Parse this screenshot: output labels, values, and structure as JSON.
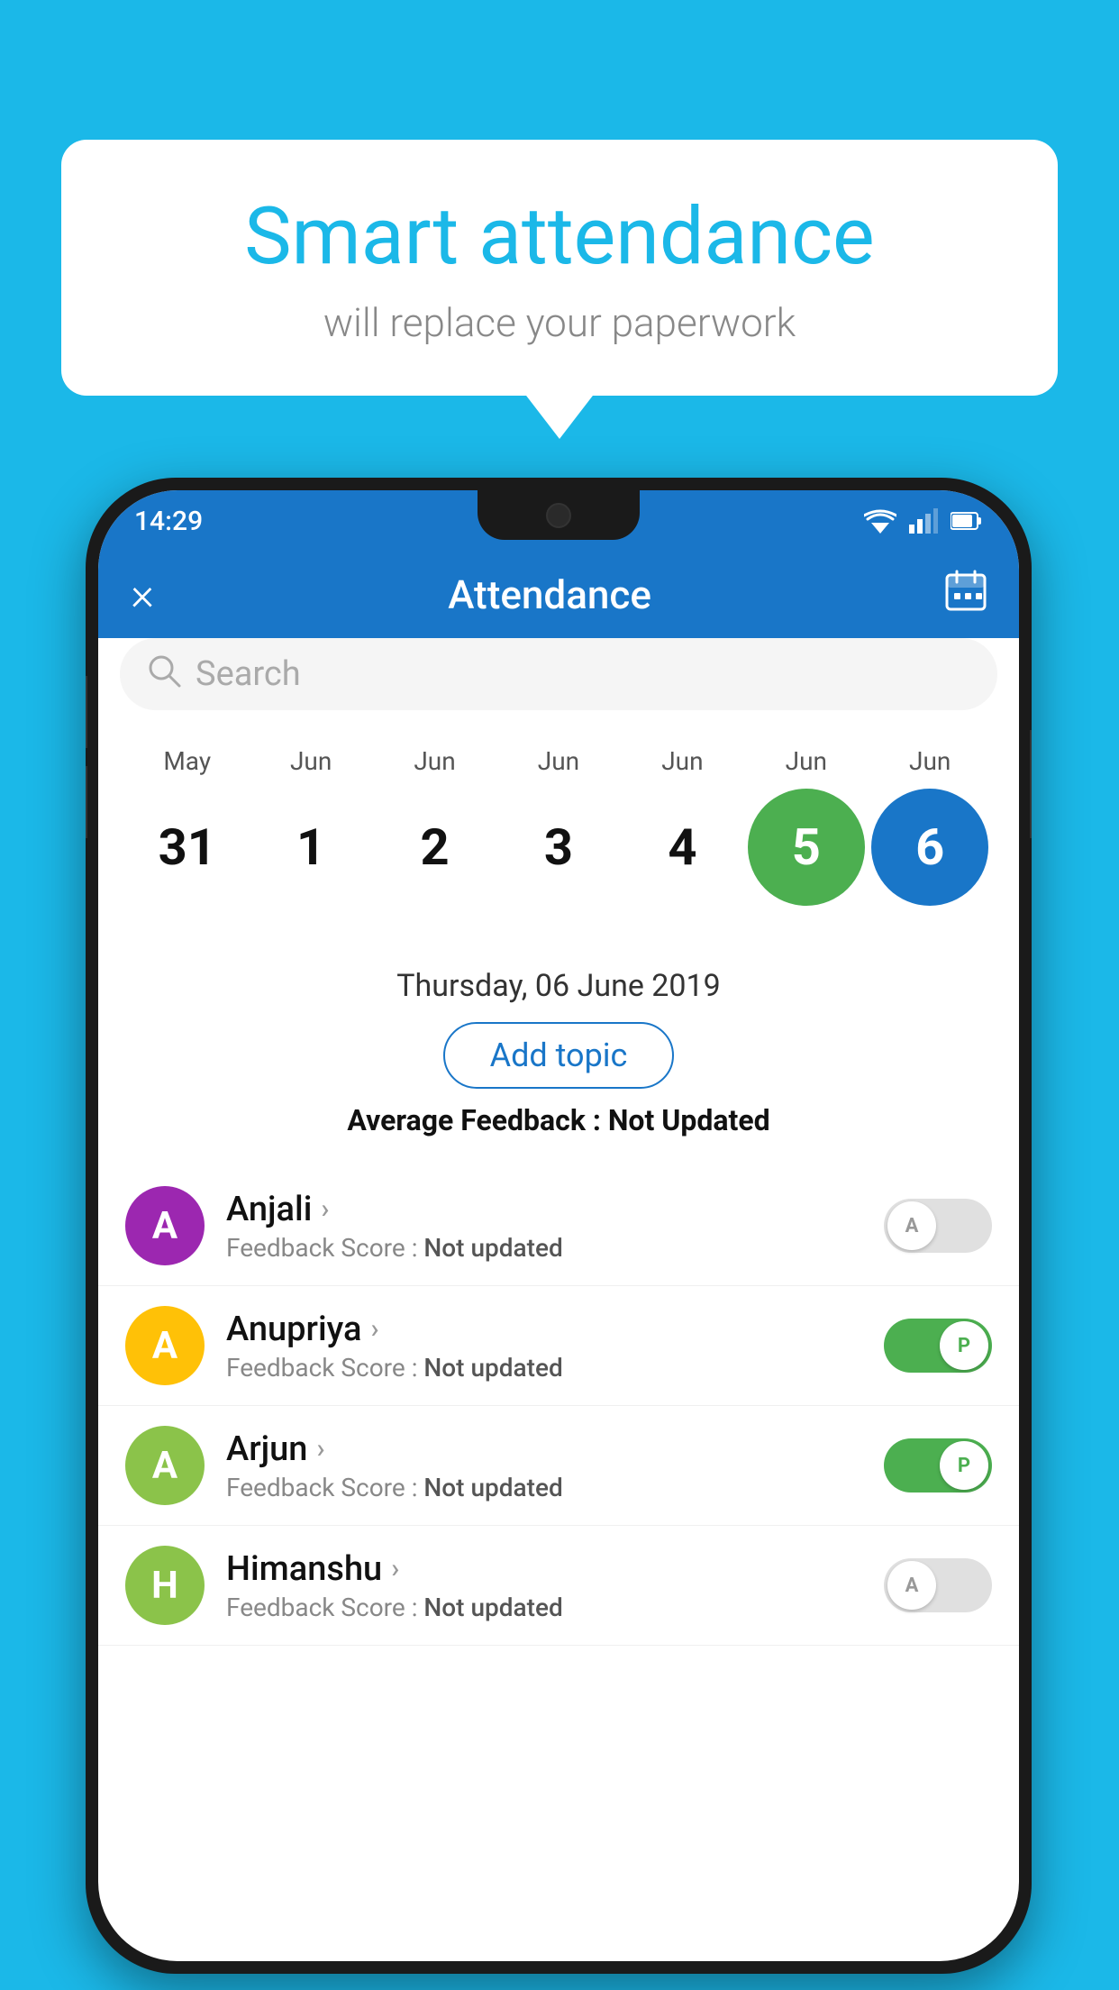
{
  "background": {
    "color": "#1BB8E8"
  },
  "speech_bubble": {
    "title": "Smart attendance",
    "subtitle": "will replace your paperwork"
  },
  "status_bar": {
    "time": "14:29"
  },
  "app_bar": {
    "title": "Attendance",
    "close_label": "×",
    "calendar_icon": "📅"
  },
  "search": {
    "placeholder": "Search"
  },
  "calendar": {
    "months": [
      "May",
      "Jun",
      "Jun",
      "Jun",
      "Jun",
      "Jun",
      "Jun"
    ],
    "dates": [
      "31",
      "1",
      "2",
      "3",
      "4",
      "5",
      "6"
    ],
    "today_green_index": 5,
    "today_blue_index": 6,
    "selected_date": "Thursday, 06 June 2019"
  },
  "add_topic": {
    "label": "Add topic"
  },
  "avg_feedback": {
    "label": "Average Feedback : ",
    "value": "Not Updated"
  },
  "students": [
    {
      "name": "Anjali",
      "initial": "A",
      "avatar_color": "#9C27B0",
      "feedback_label": "Feedback Score : ",
      "feedback_value": "Not updated",
      "toggle_state": "off",
      "toggle_label": "A"
    },
    {
      "name": "Anupriya",
      "initial": "A",
      "avatar_color": "#FFC107",
      "feedback_label": "Feedback Score : ",
      "feedback_value": "Not updated",
      "toggle_state": "on",
      "toggle_label": "P"
    },
    {
      "name": "Arjun",
      "initial": "A",
      "avatar_color": "#8BC34A",
      "feedback_label": "Feedback Score : ",
      "feedback_value": "Not updated",
      "toggle_state": "on",
      "toggle_label": "P"
    },
    {
      "name": "Himanshu",
      "initial": "H",
      "avatar_color": "#8BC34A",
      "feedback_label": "Feedback Score : ",
      "feedback_value": "Not updated",
      "toggle_state": "off",
      "toggle_label": "A"
    }
  ]
}
